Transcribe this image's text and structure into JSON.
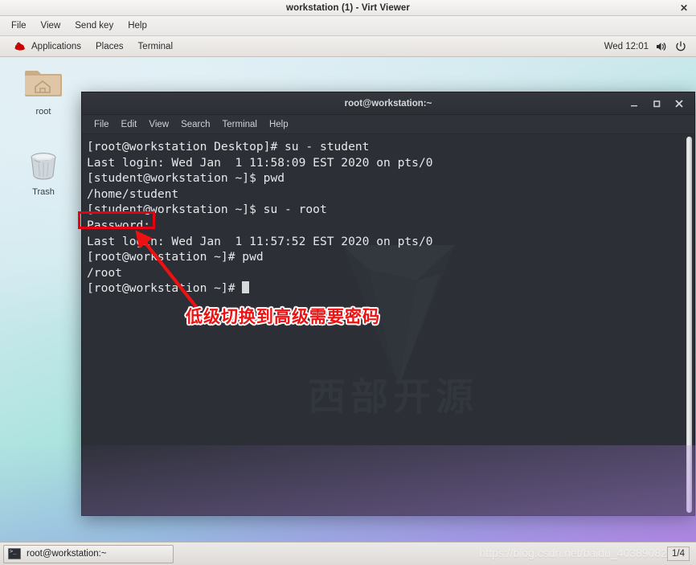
{
  "viewer": {
    "title": "workstation (1) - Virt Viewer",
    "close_label": "✕",
    "menu": [
      "File",
      "View",
      "Send key",
      "Help"
    ]
  },
  "gnome_panel": {
    "applications": "Applications",
    "places": "Places",
    "terminal": "Terminal",
    "clock": "Wed 12:01",
    "volume_icon": "volume-icon",
    "power_icon": "power-icon",
    "logo_icon": "red-hat-logo-icon"
  },
  "desktop": {
    "icons": [
      {
        "label": "root",
        "icon": "home-folder-icon"
      },
      {
        "label": "Trash",
        "icon": "trash-can-icon"
      }
    ]
  },
  "terminal": {
    "title": "root@workstation:~",
    "menu": [
      "File",
      "Edit",
      "View",
      "Search",
      "Terminal",
      "Help"
    ],
    "window_buttons": {
      "minimize": "–",
      "maximize": "□",
      "close": "✕"
    },
    "watermark_text": "西部开源",
    "lines": [
      "[root@workstation Desktop]# su - student",
      "Last login: Wed Jan  1 11:58:09 EST 2020 on pts/0",
      "[student@workstation ~]$ pwd",
      "/home/student",
      "[student@workstation ~]$ su - root",
      "Password:",
      "Last login: Wed Jan  1 11:57:52 EST 2020 on pts/0",
      "[root@workstation ~]# pwd",
      "/root",
      "[root@workstation ~]# "
    ]
  },
  "annotation": {
    "text": "低级切换到高级需要密码",
    "color": "#ee1111",
    "highlight_target": "Password:"
  },
  "taskbar": {
    "window_button": "root@workstation:~",
    "workspace": "1/4",
    "watermark": "https://blog.csdn.net/baidu_40389082"
  }
}
